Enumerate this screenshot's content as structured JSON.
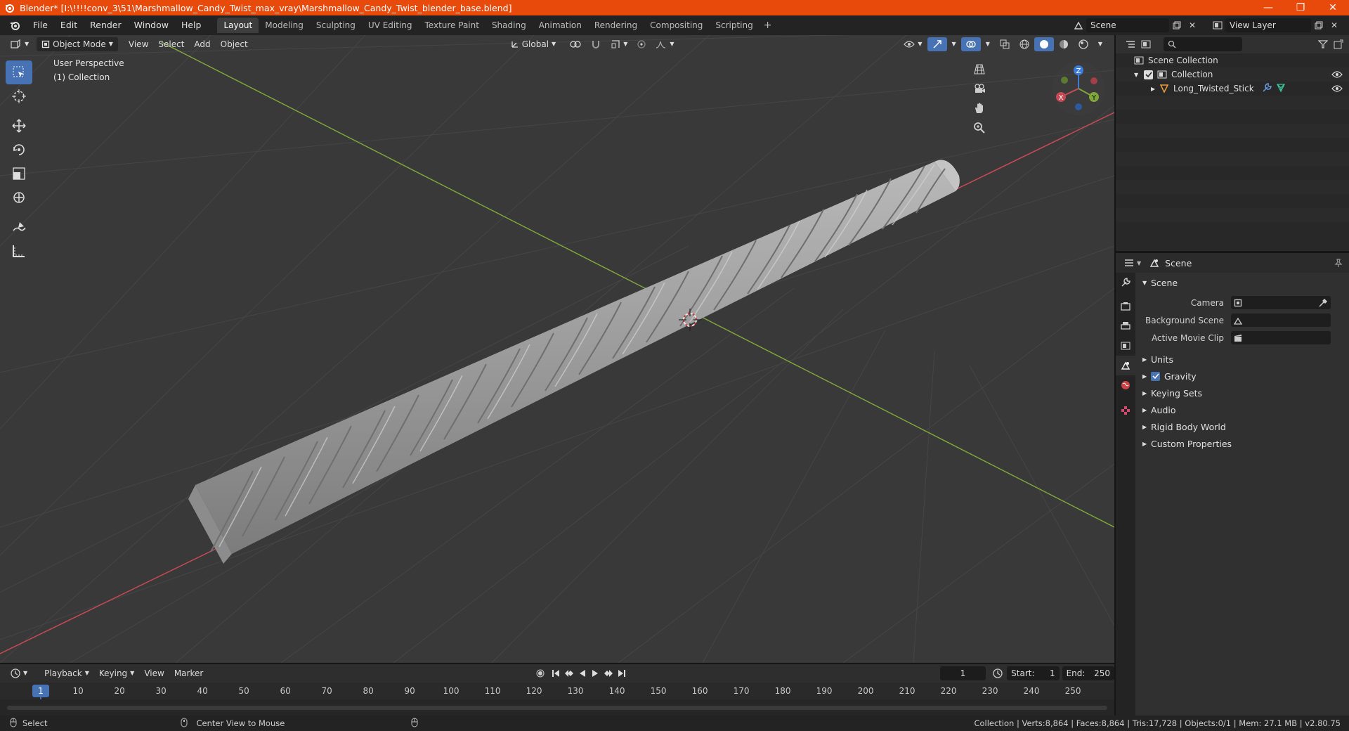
{
  "window": {
    "title": "Blender* [I:\\!!!!conv_3\\51\\Marshmallow_Candy_Twist_max_vray\\Marshmallow_Candy_Twist_blender_base.blend]",
    "minimize": "—",
    "restore": "❐",
    "close": "✕"
  },
  "menu": [
    "File",
    "Edit",
    "Render",
    "Window",
    "Help"
  ],
  "workspaces": [
    "Layout",
    "Modeling",
    "Sculpting",
    "UV Editing",
    "Texture Paint",
    "Shading",
    "Animation",
    "Rendering",
    "Compositing",
    "Scripting"
  ],
  "workspace_add": "+",
  "scene_field": "Scene",
  "view_layer_field": "View Layer",
  "viewport": {
    "mode": "Object Mode",
    "menus": [
      "View",
      "Select",
      "Add",
      "Object"
    ],
    "orientation": "Global",
    "info_line1": "User Perspective",
    "info_line2": "(1) Collection",
    "gizmo_axes": {
      "z": "Z",
      "y": "Y",
      "x": "X"
    }
  },
  "outliner": {
    "root": "Scene Collection",
    "collection": "Collection",
    "object": "Long_Twisted_Stick"
  },
  "properties": {
    "header": "Scene",
    "section": "Scene",
    "fields": [
      {
        "label": "Camera"
      },
      {
        "label": "Background Scene"
      },
      {
        "label": "Active Movie Clip"
      }
    ],
    "subsections": [
      "Units",
      "Gravity",
      "Keying Sets",
      "Audio",
      "Rigid Body World",
      "Custom Properties"
    ]
  },
  "timeline": {
    "menus": [
      "Playback",
      "Keying",
      "View",
      "Marker"
    ],
    "current_frame": "1",
    "start_label": "Start:",
    "start": "1",
    "end_label": "End:",
    "end": "250",
    "ruler": [
      "1",
      "10",
      "20",
      "30",
      "40",
      "50",
      "60",
      "70",
      "80",
      "90",
      "100",
      "110",
      "120",
      "130",
      "140",
      "150",
      "160",
      "170",
      "180",
      "190",
      "200",
      "210",
      "220",
      "230",
      "240",
      "250"
    ]
  },
  "status": {
    "left": "Select",
    "middle": "Center View to Mouse",
    "right": "Collection | Verts:8,864 | Faces:8,864 | Tris:17,728 | Objects:0/1 | Mem: 27.1 MB | v2.80.75"
  },
  "colors": {
    "titlebar": "#e84a0c",
    "accent": "#4772b3",
    "axis_x": "#c74a54",
    "axis_y": "#7fa63b",
    "axis_z": "#3d7bd6"
  }
}
